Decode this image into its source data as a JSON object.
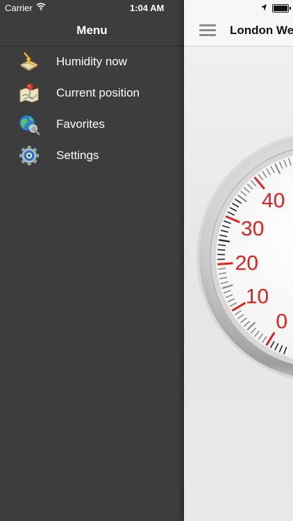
{
  "status_bar": {
    "carrier": "Carrier",
    "time": "1:04 AM",
    "icons": [
      "wifi-icon",
      "location-arrow-icon",
      "battery-icon"
    ]
  },
  "menu": {
    "title": "Menu",
    "items": [
      {
        "label": "Humidity now",
        "icon": "humidity-map-icon"
      },
      {
        "label": "Current position",
        "icon": "map-pin-icon"
      },
      {
        "label": "Favorites",
        "icon": "globe-search-icon"
      },
      {
        "label": "Settings",
        "icon": "gear-icon"
      }
    ]
  },
  "main": {
    "nav_title": "London We",
    "menu_button_icon": "hamburger-icon",
    "gauge": {
      "tick_labels": [
        "0",
        "10",
        "20",
        "30",
        "40"
      ],
      "accent_color": "#e0201c"
    }
  }
}
